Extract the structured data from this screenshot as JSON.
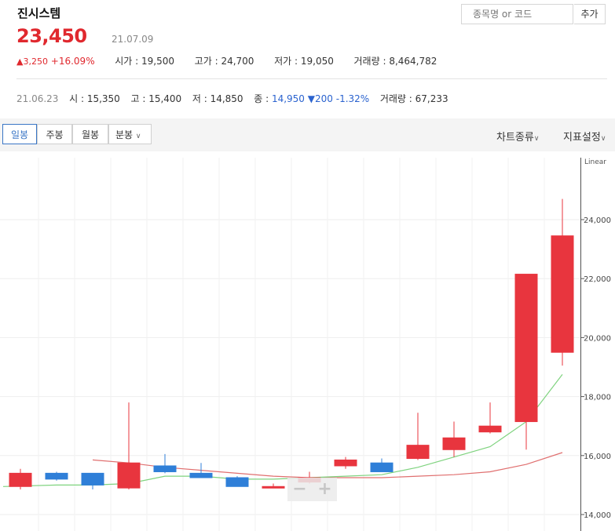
{
  "header": {
    "name": "진시스템",
    "price": "23,450",
    "date": "21.07.09",
    "change": "▲3,250",
    "change_pct": "+16.09%",
    "open_label": "시가 : ",
    "open": "19,500",
    "high_label": "고가 : ",
    "high": "24,700",
    "low_label": "저가 : ",
    "low": "19,050",
    "volume_label": "거래량 : ",
    "volume": "8,464,782"
  },
  "search": {
    "placeholder": "종목명 or 코드",
    "add_label": "추가"
  },
  "prev_day": {
    "date": "21.06.23",
    "open_label": "시 : ",
    "open": "15,350",
    "high_label": "고 : ",
    "high": "15,400",
    "low_label": "저 : ",
    "low": "14,850",
    "close_label": "종 : ",
    "close": "14,950",
    "change": "▼200",
    "change_pct": "-1.32%",
    "volume_label": "거래량 : ",
    "volume": "67,233"
  },
  "toolbar": {
    "tabs": [
      "일봉",
      "주봉",
      "월봉",
      "분봉"
    ],
    "active_tab": "일봉",
    "chart_type_label": "차트종류",
    "indicator_label": "지표설정"
  },
  "colors": {
    "up": "#e8353e",
    "down": "#2f7fd8",
    "ma_short": "#7fd37f",
    "ma_long": "#e06f6f"
  },
  "chart_data": {
    "type": "candlestick",
    "scale": "Linear",
    "ylim": [
      14000,
      25200
    ],
    "yticks": [
      "14,000",
      "16,000",
      "18,000",
      "20,000",
      "22,000",
      "24,000"
    ],
    "ytick_values": [
      14000,
      16000,
      18000,
      20000,
      22000,
      24000
    ],
    "candles": [
      {
        "open": 14950,
        "high": 15550,
        "low": 14850,
        "close": 15400
      },
      {
        "open": 15400,
        "high": 15450,
        "low": 15150,
        "close": 15200
      },
      {
        "open": 15400,
        "high": 15400,
        "low": 14850,
        "close": 15000
      },
      {
        "open": 14900,
        "high": 17800,
        "low": 14850,
        "close": 15750
      },
      {
        "open": 15650,
        "high": 16050,
        "low": 15400,
        "close": 15450
      },
      {
        "open": 15400,
        "high": 15750,
        "low": 15250,
        "close": 15250
      },
      {
        "open": 15250,
        "high": 15300,
        "low": 15000,
        "close": 14950
      },
      {
        "open": 14950,
        "high": 15050,
        "low": 14900,
        "close": 14950
      },
      {
        "open": 15100,
        "high": 15450,
        "low": 15050,
        "close": 15250
      },
      {
        "open": 15650,
        "high": 15950,
        "low": 15550,
        "close": 15850
      },
      {
        "open": 15750,
        "high": 15900,
        "low": 15500,
        "close": 15450
      },
      {
        "open": 15900,
        "high": 17450,
        "low": 15850,
        "close": 16350
      },
      {
        "open": 16200,
        "high": 17150,
        "low": 15950,
        "close": 16600
      },
      {
        "open": 16800,
        "high": 17800,
        "low": 16750,
        "close": 17000
      },
      {
        "open": 17150,
        "high": 21850,
        "low": 16200,
        "close": 22150
      },
      {
        "open": 19500,
        "high": 24700,
        "low": 19050,
        "close": 23450
      }
    ],
    "ma_short": [
      14950,
      15000,
      15000,
      15050,
      15300,
      15300,
      15200,
      15200,
      15250,
      15300,
      15350,
      15600,
      15950,
      16300,
      17150,
      18750
    ],
    "ma_long": [
      null,
      null,
      15850,
      15750,
      15600,
      15500,
      15400,
      15300,
      15250,
      15250,
      15250,
      15300,
      15350,
      15450,
      15700,
      16100
    ]
  }
}
